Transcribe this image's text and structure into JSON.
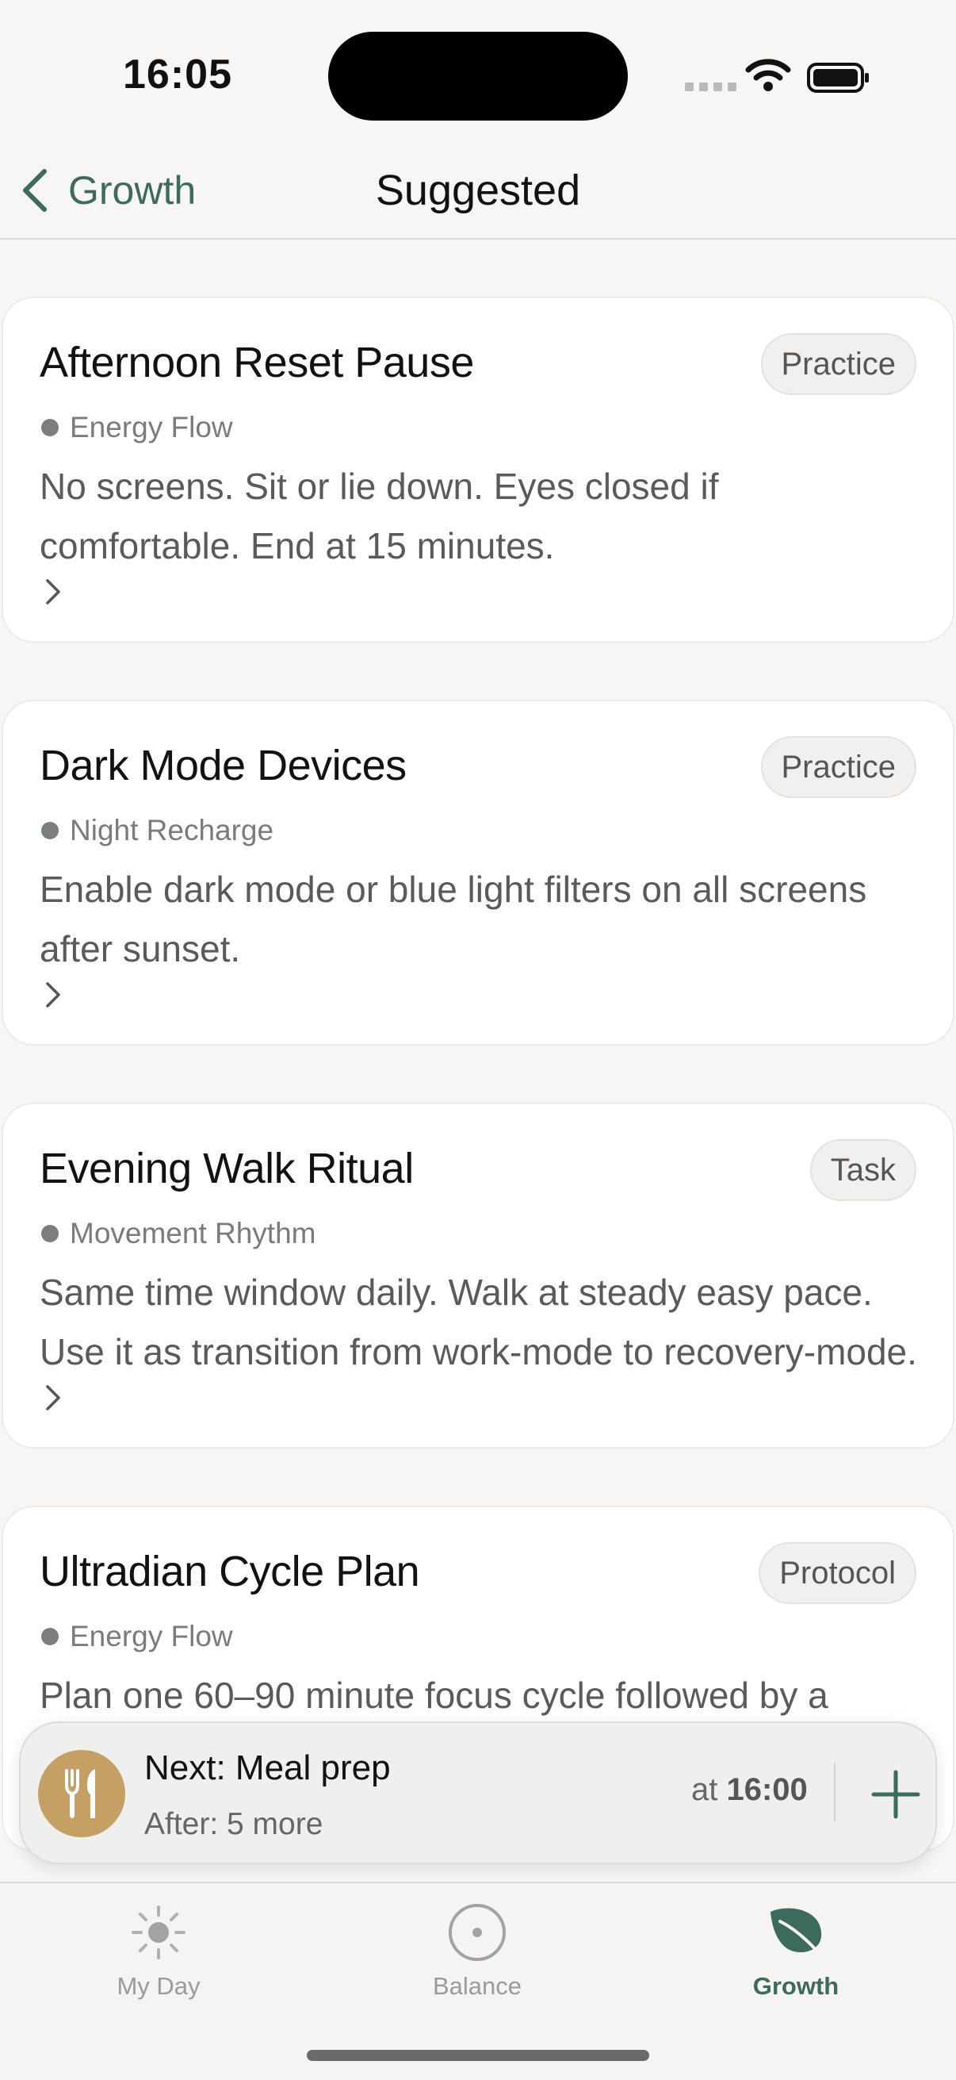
{
  "status_bar": {
    "time": "16:05"
  },
  "nav": {
    "back_label": "Growth",
    "title": "Suggested"
  },
  "cards": [
    {
      "title": "Afternoon Reset Pause",
      "badge": "Practice",
      "category": "Energy Flow",
      "description": "No screens. Sit or lie down. Eyes closed if comfortable. End at 15 minutes."
    },
    {
      "title": "Dark Mode Devices",
      "badge": "Practice",
      "category": "Night Recharge",
      "description": "Enable dark mode or blue light filters on all screens after sunset."
    },
    {
      "title": "Evening Walk Ritual",
      "badge": "Task",
      "category": "Movement Rhythm",
      "description_line1": "Same time window daily. Walk at steady easy pace.",
      "description_line2": "Use it as transition from work-mode to recovery-mode."
    },
    {
      "title": "Ultradian Cycle Plan",
      "badge": "Protocol",
      "category": "Energy Flow",
      "description": "Plan one 60–90 minute focus cycle followed by a"
    }
  ],
  "next": {
    "title": "Next: Meal prep",
    "subtitle": "After: 5 more",
    "at_label": "at",
    "time": "16:00"
  },
  "tabs": [
    {
      "label": "My Day",
      "active": false
    },
    {
      "label": "Balance",
      "active": false
    },
    {
      "label": "Growth",
      "active": true
    }
  ],
  "colors": {
    "accent": "#3c6b5e",
    "meal_icon_bg": "#c4a064",
    "background": "#f7f6f4"
  }
}
